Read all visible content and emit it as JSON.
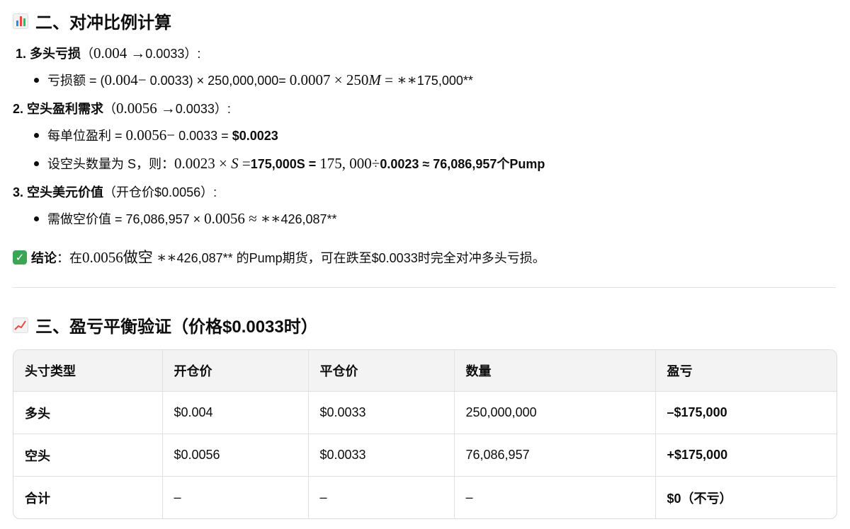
{
  "section2": {
    "title": "二、对冲比例计算",
    "item1": {
      "num": "1.",
      "label": "多头亏损",
      "paren_open": "（",
      "m_a": "0.004",
      "arrow": "→",
      "b": "0.0033",
      "paren_close": "）:",
      "bullet_label": "亏损额 = (",
      "m_c": "0.004",
      "minus": "−",
      "d": " 0.0033) × 250,000,000= ",
      "m_e": "0.0007 × 250",
      "m_f": "M",
      "m_g": " =  ∗∗",
      "h": "175,000**"
    },
    "item2": {
      "num": "2.",
      "label": "空头盈利需求",
      "paren_open": "（",
      "m_a": "0.0056",
      "arrow": "→",
      "b": "0.0033",
      "paren_close": "）:",
      "b1_label": "每单位盈利 = ",
      "b1_m": "0.0056",
      "b1_minus": "−",
      "b1_rest": " 0.0033 = ",
      "b1_bold": "$0.0023",
      "b2_label": "设空头数量为 S，则：",
      "b2_m1": "0.0023 × ",
      "b2_mi": "S",
      "b2_m2": " =",
      "b2_bold1": "175,000S = ",
      "b2_m3": "175, 000÷",
      "b2_bold2": "0.0023 ≈ 76,086,957个Pump"
    },
    "item3": {
      "num": "3.",
      "label": "空头美元价值",
      "rest": "（开仓价$0.0056）:",
      "b_label": "需做空价值 = 76,086,957 × ",
      "b_m": "0.0056 ≈  ∗∗",
      "b_rest": "426,087**"
    },
    "conclusion": {
      "check": "✓",
      "label": "结论",
      "t1": "：在",
      "m1": "0.0056做空 ∗∗",
      "t2": "426,087** 的Pump期货，可在跌至$0.0033时完全对冲多头亏损。"
    }
  },
  "section3": {
    "title": "三、盈亏平衡验证（价格$0.0033时）",
    "table": {
      "headers": [
        "头寸类型",
        "开仓价",
        "平仓价",
        "数量",
        "盈亏"
      ],
      "rows": [
        [
          "多头",
          "$0.004",
          "$0.0033",
          "250,000,000",
          "–$175,000"
        ],
        [
          "空头",
          "$0.0056",
          "$0.0033",
          "76,086,957",
          "+$175,000"
        ],
        [
          "合计",
          "–",
          "–",
          "–",
          "$0（不亏）"
        ]
      ]
    }
  },
  "colors": {
    "check_green": "#3aa655",
    "header_bg": "#f3f3f3",
    "border": "#dcdcdc"
  },
  "icons": {
    "section2": "bar-chart-icon",
    "section3": "line-chart-icon",
    "conclusion": "check-mark-icon"
  }
}
